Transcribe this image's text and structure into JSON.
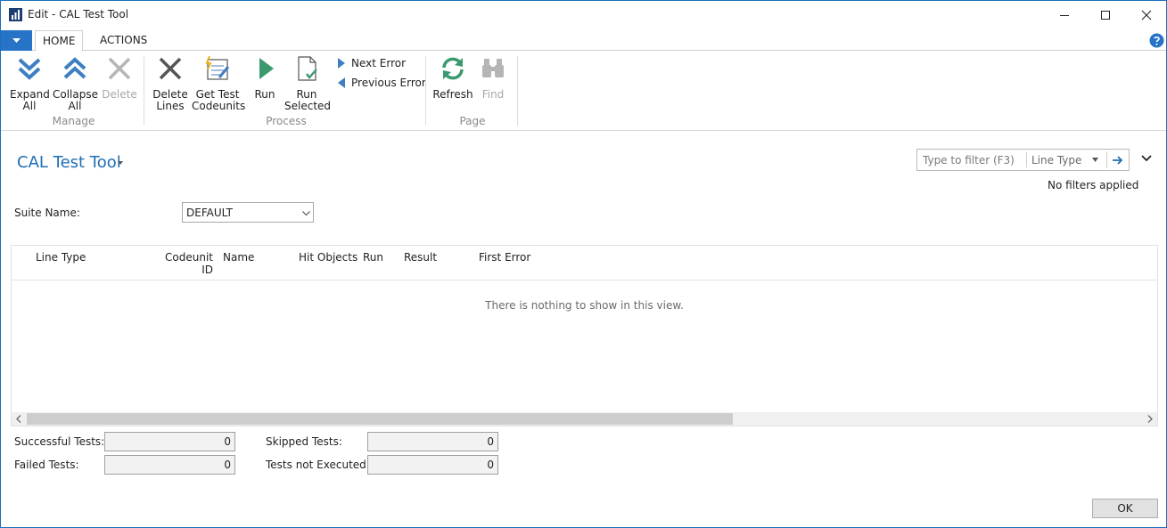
{
  "window": {
    "title": "Edit - CAL Test Tool"
  },
  "tabs": [
    {
      "label": "HOME"
    },
    {
      "label": "ACTIONS"
    }
  ],
  "ribbon": {
    "manage": {
      "label": "Manage",
      "expand_all": [
        "Expand",
        "All"
      ],
      "collapse_all": [
        "Collapse",
        "All"
      ],
      "delete": "Delete"
    },
    "process": {
      "label": "Process",
      "delete_lines": [
        "Delete",
        "Lines"
      ],
      "get_test_codeunits": [
        "Get Test",
        "Codeunits"
      ],
      "run": "Run",
      "run_selected": [
        "Run",
        "Selected"
      ],
      "next_error": "Next Error",
      "previous_error": "Previous Error"
    },
    "page": {
      "label": "Page",
      "refresh": "Refresh",
      "find": "Find"
    }
  },
  "page": {
    "title": "CAL Test Tool",
    "filter": {
      "placeholder": "Type to filter (F3)",
      "field": "Line Type"
    },
    "filter_status": "No filters applied"
  },
  "suite": {
    "label": "Suite Name:",
    "value": "DEFAULT"
  },
  "grid": {
    "columns": [
      "Line Type",
      "Codeunit",
      "ID",
      "Name",
      "Hit Objects",
      "Run",
      "Result",
      "First Error"
    ],
    "empty_message": "There is nothing to show in this view."
  },
  "totals": {
    "successful": {
      "label": "Successful Tests:",
      "value": "0"
    },
    "failed": {
      "label": "Failed Tests:",
      "value": "0"
    },
    "skipped": {
      "label": "Skipped Tests:",
      "value": "0"
    },
    "not_executed": {
      "label": "Tests not Executed:",
      "value": "0"
    }
  },
  "ok_label": "OK",
  "colors": {
    "accent": "#1f6fb4",
    "menu": "#2673c8",
    "run_green": "#3a9a6e"
  },
  "icons": [
    "app-icon",
    "minimize-icon",
    "maximize-icon",
    "close-icon",
    "help-icon",
    "expand-all-icon",
    "collapse-all-icon",
    "delete-icon",
    "delete-lines-icon",
    "get-test-codeunits-icon",
    "run-icon",
    "run-selected-icon",
    "next-error-icon",
    "previous-error-icon",
    "refresh-icon",
    "find-icon",
    "arrow-right-icon",
    "chevron-down-icon"
  ]
}
